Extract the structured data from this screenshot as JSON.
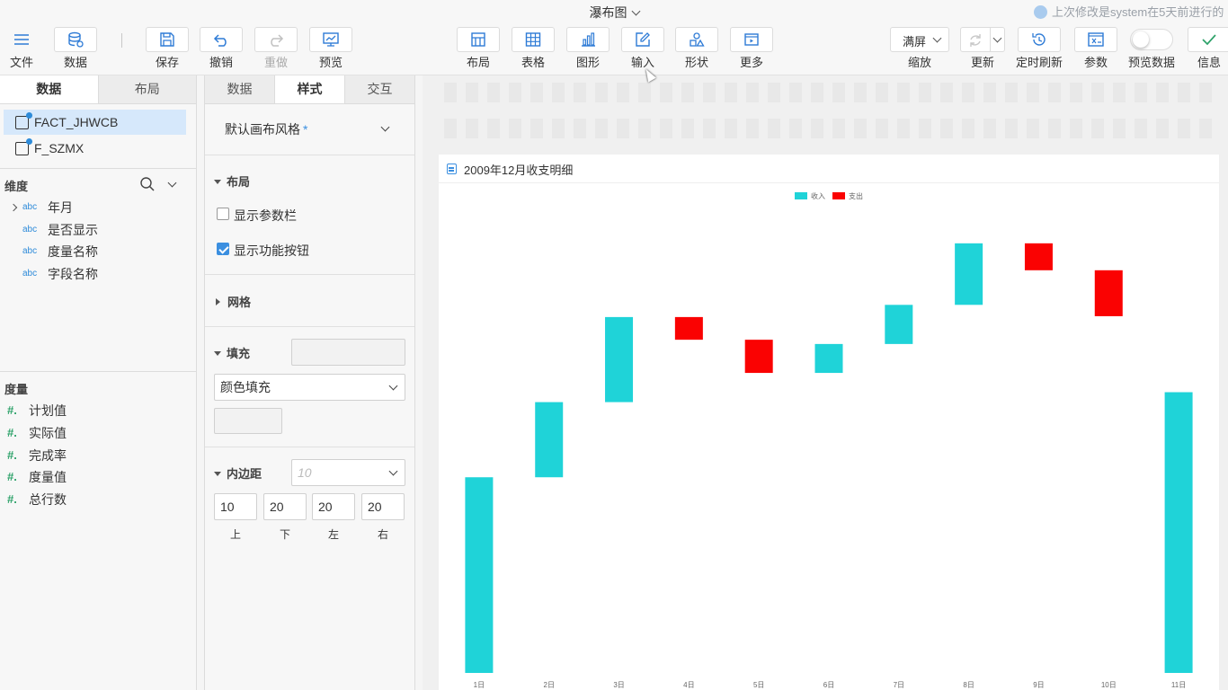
{
  "header": {
    "doc_title": "瀑布图",
    "modified_info": "上次修改是system在5天前进行的"
  },
  "toolbar": {
    "file": "文件",
    "data": "数据",
    "save": "保存",
    "undo": "撤销",
    "redo": "重做",
    "preview": "预览",
    "layout": "布局",
    "table": "表格",
    "graphic": "图形",
    "input": "输入",
    "shape": "形状",
    "more": "更多",
    "zoom_value": "满屏",
    "zoom": "缩放",
    "update": "更新",
    "timed_refresh": "定时刷新",
    "params": "参数",
    "preview_data": "预览数据",
    "info": "信息"
  },
  "left_panel": {
    "tabs": [
      "数据",
      "布局"
    ],
    "tables": [
      "FACT_JHWCB",
      "F_SZMX"
    ],
    "dimensions_title": "维度",
    "dimensions": [
      "年月",
      "是否显示",
      "度量名称",
      "字段名称"
    ],
    "dimension_type_label": "abc",
    "measures_title": "度量",
    "measures": [
      "计划值",
      "实际值",
      "完成率",
      "度量值",
      "总行数"
    ],
    "measure_type_label": "#."
  },
  "style_panel": {
    "tabs": [
      "数据",
      "样式",
      "交互"
    ],
    "canvas_style": "默认画布风格",
    "canvas_style_mark": "*",
    "layout_section": "布局",
    "show_param_bar": "显示参数栏",
    "show_function_buttons": "显示功能按钮",
    "grid_section": "网格",
    "fill_section": "填充",
    "fill_type": "颜色填充",
    "padding_section": "内边距",
    "padding_placeholder": "10",
    "padding_values": [
      "10",
      "20",
      "20",
      "20"
    ],
    "padding_labels": [
      "上",
      "下",
      "左",
      "右"
    ]
  },
  "chart_card": {
    "title": "2009年12月收支明细"
  },
  "chart_data": {
    "type": "bar",
    "subtype": "waterfall",
    "title": "2009年12月收支明细",
    "legend_position": "top-center",
    "categories": [
      "1日",
      "2日",
      "3日",
      "4日",
      "5日",
      "6日",
      "7日",
      "8日",
      "9日",
      "10日",
      "11日"
    ],
    "series": [
      {
        "name": "收入",
        "color": "#1fd3d8"
      },
      {
        "name": "支出",
        "color": "#fa0202"
      }
    ],
    "bars": [
      {
        "category": "1日",
        "series": "收入",
        "start": 0,
        "end": 690
      },
      {
        "category": "2日",
        "series": "收入",
        "start": 690,
        "end": 955
      },
      {
        "category": "3日",
        "series": "收入",
        "start": 955,
        "end": 1255
      },
      {
        "category": "4日",
        "series": "支出",
        "start": 1255,
        "end": 1175
      },
      {
        "category": "5日",
        "series": "支出",
        "start": 1175,
        "end": 1058
      },
      {
        "category": "6日",
        "series": "收入",
        "start": 1058,
        "end": 1160
      },
      {
        "category": "7日",
        "series": "收入",
        "start": 1160,
        "end": 1298
      },
      {
        "category": "8日",
        "series": "收入",
        "start": 1298,
        "end": 1515
      },
      {
        "category": "9日",
        "series": "支出",
        "start": 1515,
        "end": 1420
      },
      {
        "category": "10日",
        "series": "支出",
        "start": 1420,
        "end": 1258
      },
      {
        "category": "11日",
        "series": "收入",
        "start": 0,
        "end": 990
      }
    ],
    "ylim": [
      0,
      1600
    ],
    "grid": false
  }
}
